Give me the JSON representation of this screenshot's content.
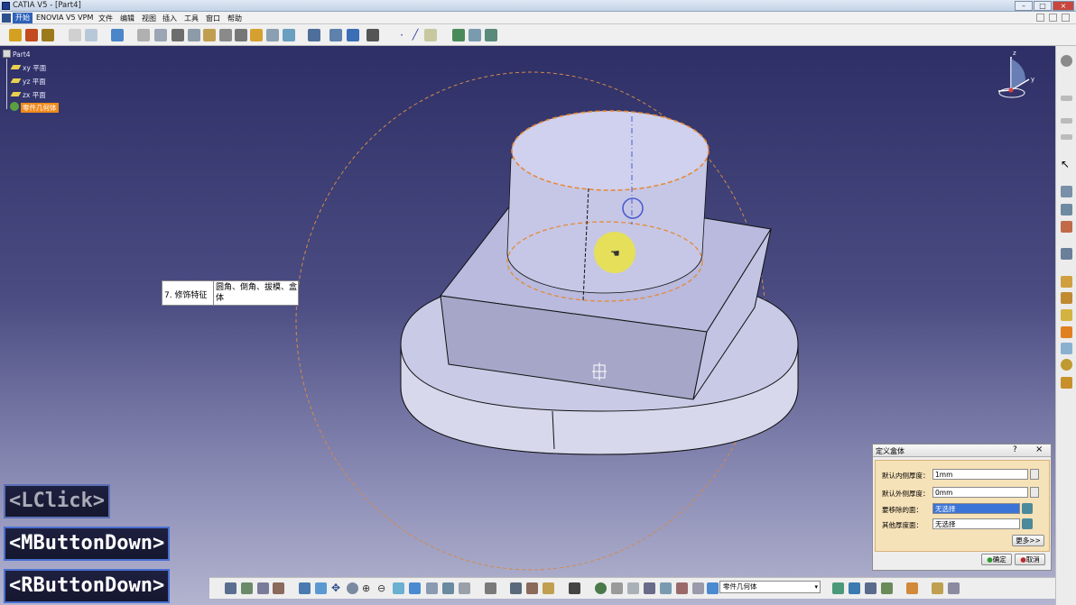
{
  "window": {
    "title": "CATIA V5 - [Part4]"
  },
  "menu": [
    "开始",
    "ENOVIA V5 VPM",
    "文件",
    "编辑",
    "视图",
    "插入",
    "工具",
    "窗口",
    "帮助"
  ],
  "tree": {
    "root": "Part4",
    "items": [
      {
        "label": "xy 平面"
      },
      {
        "label": "yz 平面"
      },
      {
        "label": "zx 平面"
      },
      {
        "label": "零件几何体",
        "selected": true
      }
    ]
  },
  "tooltip": {
    "left": "7. 修饰特征",
    "right": "圆角、倒角、拔模、盒体"
  },
  "dialog": {
    "title": "定义盒体",
    "help_btn": "?",
    "close_btn": "×",
    "fields": [
      {
        "label": "默认内侧厚度：",
        "value": "1mm"
      },
      {
        "label": "默认外侧厚度：",
        "value": "0mm"
      },
      {
        "label": "要移除的面：",
        "value": "无选择"
      },
      {
        "label": "其他厚度面：",
        "value": "无选择"
      }
    ],
    "more": "更多>>",
    "ok": "确定",
    "cancel": "取消"
  },
  "keys": {
    "lclick": "<LClick>",
    "mbutton": "<MButtonDown>",
    "rbutton": "<RButtonDown>"
  },
  "bottom_combo": "零件几何体",
  "compass": {
    "z": "z",
    "y": "y"
  },
  "colors": {
    "viewport_top": "#2d2f66",
    "viewport_bottom": "#b3b4cf",
    "selection": "#f08a1c",
    "highlight_edge": "#e58a3a",
    "key_border": "#4a6fd1"
  }
}
